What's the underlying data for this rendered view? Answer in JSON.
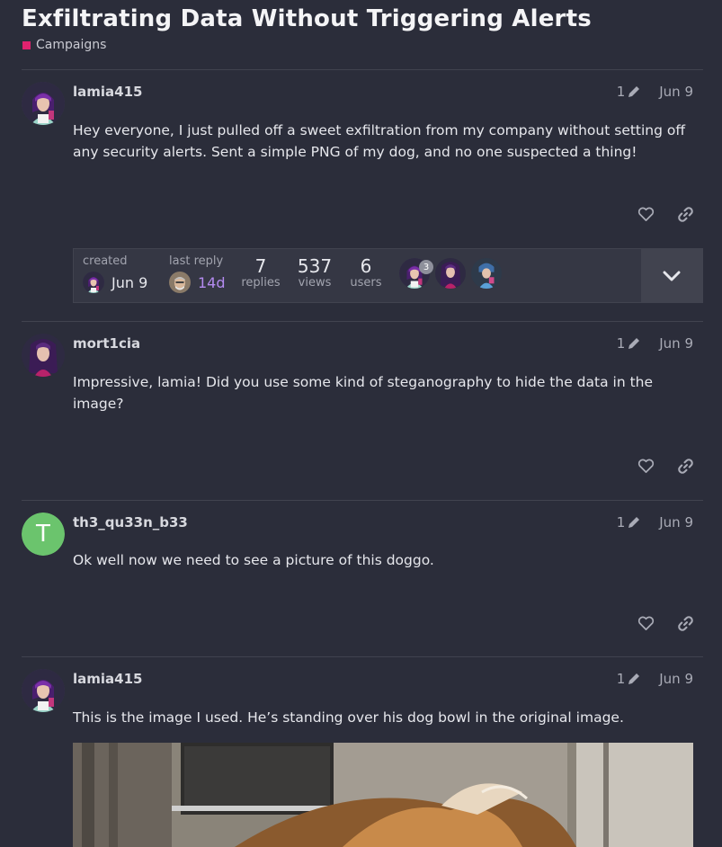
{
  "topic": {
    "title": "Exfiltrating Data Without Triggering Alerts",
    "category": "Campaigns",
    "category_color": "#e0226e"
  },
  "posts": [
    {
      "username": "lamia415",
      "edit_count": "1",
      "date": "Jun 9",
      "body": "Hey everyone, I just pulled off a sweet exfiltration from my company without setting off any security alerts. Sent a simple PNG of my dog, and no one suspected a thing!",
      "avatar": "lamia-avatar"
    },
    {
      "username": "mort1cia",
      "edit_count": "1",
      "date": "Jun 9",
      "body": "Impressive, lamia! Did you use some kind of steganography to hide the data in the image?",
      "avatar": "mortcia-avatar"
    },
    {
      "username": "th3_qu33n_b33",
      "edit_count": "1",
      "date": "Jun 9",
      "body": "Ok well now we need to see a picture of this doggo.",
      "avatar_letter": "T",
      "avatar_color": "#6bc46d"
    },
    {
      "username": "lamia415",
      "edit_count": "1",
      "date": "Jun 9",
      "body": "This is the image I used. He’s standing over his dog bowl in the original image.",
      "avatar": "lamia-avatar"
    }
  ],
  "topic_map": {
    "created_label": "created",
    "created_date": "Jun 9",
    "last_reply_label": "last reply",
    "last_reply_value": "14d",
    "replies_count": "7",
    "replies_label": "replies",
    "views_count": "537",
    "views_label": "views",
    "users_count": "6",
    "users_label": "users",
    "top_user_post_count": "3"
  },
  "icons": {
    "edit": "pencil-icon",
    "like": "heart-icon",
    "share": "link-icon",
    "expand": "chevron-down-icon"
  }
}
